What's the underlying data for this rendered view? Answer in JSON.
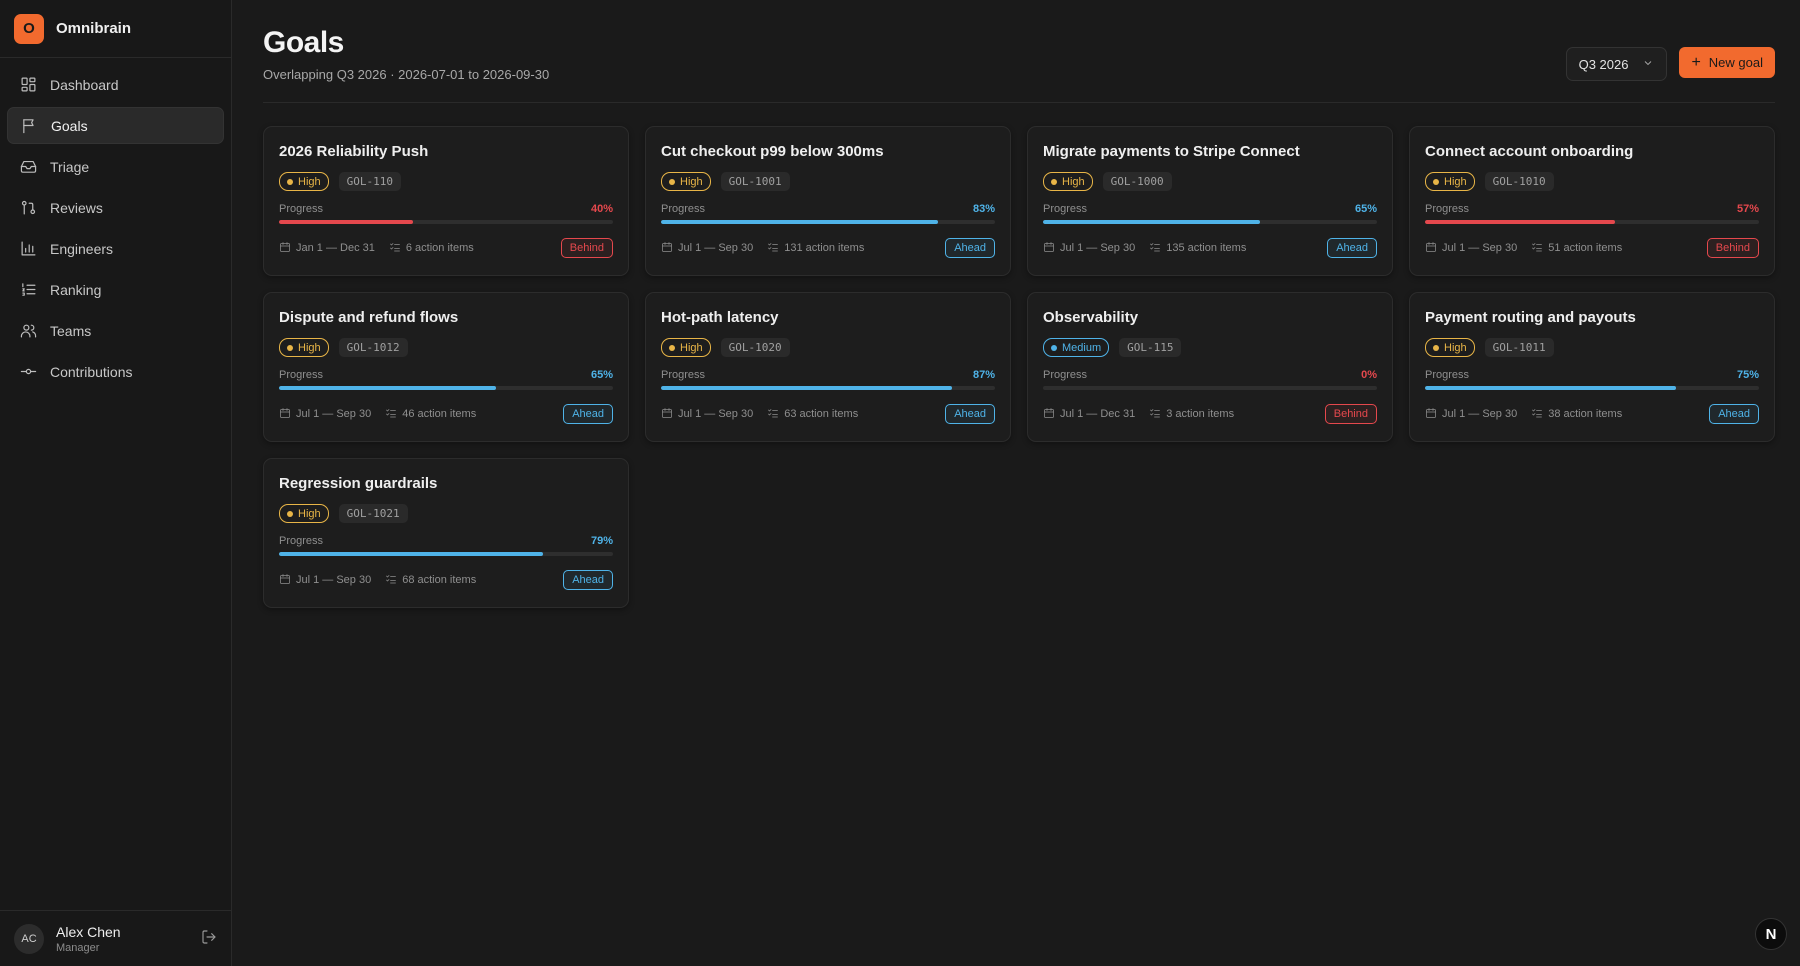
{
  "brand": {
    "logo": "O",
    "name": "Omnibrain"
  },
  "sidebar": {
    "items": [
      {
        "label": "Dashboard",
        "icon": "dashboard-icon",
        "active": false
      },
      {
        "label": "Goals",
        "icon": "flag-icon",
        "active": true
      },
      {
        "label": "Triage",
        "icon": "inbox-icon",
        "active": false
      },
      {
        "label": "Reviews",
        "icon": "git-pull-request-icon",
        "active": false
      },
      {
        "label": "Engineers",
        "icon": "bar-chart-icon",
        "active": false
      },
      {
        "label": "Ranking",
        "icon": "list-ordered-icon",
        "active": false
      },
      {
        "label": "Teams",
        "icon": "users-icon",
        "active": false
      },
      {
        "label": "Contributions",
        "icon": "git-commit-icon",
        "active": false
      }
    ]
  },
  "user": {
    "initials": "AC",
    "name": "Alex Chen",
    "role": "Manager"
  },
  "header": {
    "title": "Goals",
    "subtitle": "Overlapping Q3 2026 · 2026-07-01 to 2026-09-30",
    "quarter": "Q3 2026",
    "new_goal_label": "New goal"
  },
  "colors": {
    "accent": "#f26a2e",
    "high": "#e8b547",
    "medium": "#4fb3e8",
    "ahead": "#4fb3e8",
    "behind": "#e5484d"
  },
  "progress_label": "Progress",
  "goals": [
    {
      "title": "2026 Reliability Push",
      "priority": "High",
      "id": "GOL-110",
      "progress": 40,
      "dates": "Jan 1 — Dec 31",
      "action_items": "6 action items",
      "status": "Behind"
    },
    {
      "title": "Cut checkout p99 below 300ms",
      "priority": "High",
      "id": "GOL-1001",
      "progress": 83,
      "dates": "Jul 1 — Sep 30",
      "action_items": "131 action items",
      "status": "Ahead"
    },
    {
      "title": "Migrate payments to Stripe Connect",
      "priority": "High",
      "id": "GOL-1000",
      "progress": 65,
      "dates": "Jul 1 — Sep 30",
      "action_items": "135 action items",
      "status": "Ahead"
    },
    {
      "title": "Connect account onboarding",
      "priority": "High",
      "id": "GOL-1010",
      "progress": 57,
      "dates": "Jul 1 — Sep 30",
      "action_items": "51 action items",
      "status": "Behind"
    },
    {
      "title": "Dispute and refund flows",
      "priority": "High",
      "id": "GOL-1012",
      "progress": 65,
      "dates": "Jul 1 — Sep 30",
      "action_items": "46 action items",
      "status": "Ahead"
    },
    {
      "title": "Hot-path latency",
      "priority": "High",
      "id": "GOL-1020",
      "progress": 87,
      "dates": "Jul 1 — Sep 30",
      "action_items": "63 action items",
      "status": "Ahead"
    },
    {
      "title": "Observability",
      "priority": "Medium",
      "id": "GOL-115",
      "progress": 0,
      "dates": "Jul 1 — Dec 31",
      "action_items": "3 action items",
      "status": "Behind"
    },
    {
      "title": "Payment routing and payouts",
      "priority": "High",
      "id": "GOL-1011",
      "progress": 75,
      "dates": "Jul 1 — Sep 30",
      "action_items": "38 action items",
      "status": "Ahead"
    },
    {
      "title": "Regression guardrails",
      "priority": "High",
      "id": "GOL-1021",
      "progress": 79,
      "dates": "Jul 1 — Sep 30",
      "action_items": "68 action items",
      "status": "Ahead"
    }
  ],
  "fab": "N"
}
